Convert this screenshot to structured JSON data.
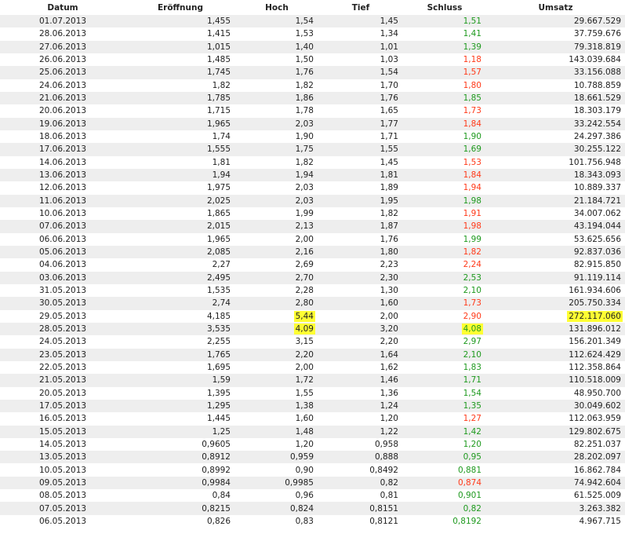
{
  "headers": [
    "Datum",
    "Eröffnung",
    "Hoch",
    "Tief",
    "Schluss",
    "Umsatz"
  ],
  "colors": {
    "up": "#1f9a1f",
    "down": "#ff3a1a",
    "highlight": "#ffff33",
    "stripe": "#eeeeee"
  },
  "rows": [
    {
      "date": "01.07.2013",
      "open": "1,455",
      "high": "1,54",
      "low": "1,45",
      "close": "1,51",
      "trend": "up",
      "volume": "29.667.529"
    },
    {
      "date": "28.06.2013",
      "open": "1,415",
      "high": "1,53",
      "low": "1,34",
      "close": "1,41",
      "trend": "up",
      "volume": "37.759.676"
    },
    {
      "date": "27.06.2013",
      "open": "1,015",
      "high": "1,40",
      "low": "1,01",
      "close": "1,39",
      "trend": "up",
      "volume": "79.318.819"
    },
    {
      "date": "26.06.2013",
      "open": "1,485",
      "high": "1,50",
      "low": "1,03",
      "close": "1,18",
      "trend": "down",
      "volume": "143.039.684"
    },
    {
      "date": "25.06.2013",
      "open": "1,745",
      "high": "1,76",
      "low": "1,54",
      "close": "1,57",
      "trend": "down",
      "volume": "33.156.088"
    },
    {
      "date": "24.06.2013",
      "open": "1,82",
      "high": "1,82",
      "low": "1,70",
      "close": "1,80",
      "trend": "down",
      "volume": "10.788.859"
    },
    {
      "date": "21.06.2013",
      "open": "1,785",
      "high": "1,86",
      "low": "1,76",
      "close": "1,85",
      "trend": "up",
      "volume": "18.661.529"
    },
    {
      "date": "20.06.2013",
      "open": "1,715",
      "high": "1,78",
      "low": "1,65",
      "close": "1,73",
      "trend": "down",
      "volume": "18.303.179"
    },
    {
      "date": "19.06.2013",
      "open": "1,965",
      "high": "2,03",
      "low": "1,77",
      "close": "1,84",
      "trend": "down",
      "volume": "33.242.554"
    },
    {
      "date": "18.06.2013",
      "open": "1,74",
      "high": "1,90",
      "low": "1,71",
      "close": "1,90",
      "trend": "up",
      "volume": "24.297.386"
    },
    {
      "date": "17.06.2013",
      "open": "1,555",
      "high": "1,75",
      "low": "1,55",
      "close": "1,69",
      "trend": "up",
      "volume": "30.255.122"
    },
    {
      "date": "14.06.2013",
      "open": "1,81",
      "high": "1,82",
      "low": "1,45",
      "close": "1,53",
      "trend": "down",
      "volume": "101.756.948"
    },
    {
      "date": "13.06.2013",
      "open": "1,94",
      "high": "1,94",
      "low": "1,81",
      "close": "1,84",
      "trend": "down",
      "volume": "18.343.093"
    },
    {
      "date": "12.06.2013",
      "open": "1,975",
      "high": "2,03",
      "low": "1,89",
      "close": "1,94",
      "trend": "down",
      "volume": "10.889.337"
    },
    {
      "date": "11.06.2013",
      "open": "2,025",
      "high": "2,03",
      "low": "1,95",
      "close": "1,98",
      "trend": "up",
      "volume": "21.184.721"
    },
    {
      "date": "10.06.2013",
      "open": "1,865",
      "high": "1,99",
      "low": "1,82",
      "close": "1,91",
      "trend": "down",
      "volume": "34.007.062"
    },
    {
      "date": "07.06.2013",
      "open": "2,015",
      "high": "2,13",
      "low": "1,87",
      "close": "1,98",
      "trend": "down",
      "volume": "43.194.044"
    },
    {
      "date": "06.06.2013",
      "open": "1,965",
      "high": "2,00",
      "low": "1,76",
      "close": "1,99",
      "trend": "up",
      "volume": "53.625.656"
    },
    {
      "date": "05.06.2013",
      "open": "2,085",
      "high": "2,16",
      "low": "1,80",
      "close": "1,82",
      "trend": "down",
      "volume": "92.837.036"
    },
    {
      "date": "04.06.2013",
      "open": "2,27",
      "high": "2,69",
      "low": "2,23",
      "close": "2,24",
      "trend": "down",
      "volume": "82.915.850"
    },
    {
      "date": "03.06.2013",
      "open": "2,495",
      "high": "2,70",
      "low": "2,30",
      "close": "2,53",
      "trend": "up",
      "volume": "91.119.114"
    },
    {
      "date": "31.05.2013",
      "open": "1,535",
      "high": "2,28",
      "low": "1,30",
      "close": "2,10",
      "trend": "up",
      "volume": "161.934.606"
    },
    {
      "date": "30.05.2013",
      "open": "2,74",
      "high": "2,80",
      "low": "1,60",
      "close": "1,73",
      "trend": "down",
      "volume": "205.750.334"
    },
    {
      "date": "29.05.2013",
      "open": "4,185",
      "high": "5,44",
      "low": "2,00",
      "close": "2,90",
      "trend": "down",
      "volume": "272.117.060",
      "highlight": [
        "high",
        "volume"
      ]
    },
    {
      "date": "28.05.2013",
      "open": "3,535",
      "high": "4,09",
      "low": "3,20",
      "close": "4,08",
      "trend": "up",
      "volume": "131.896.012",
      "highlight": [
        "high",
        "close"
      ]
    },
    {
      "date": "24.05.2013",
      "open": "2,255",
      "high": "3,15",
      "low": "2,20",
      "close": "2,97",
      "trend": "up",
      "volume": "156.201.349"
    },
    {
      "date": "23.05.2013",
      "open": "1,765",
      "high": "2,20",
      "low": "1,64",
      "close": "2,10",
      "trend": "up",
      "volume": "112.624.429"
    },
    {
      "date": "22.05.2013",
      "open": "1,695",
      "high": "2,00",
      "low": "1,62",
      "close": "1,83",
      "trend": "up",
      "volume": "112.358.864"
    },
    {
      "date": "21.05.2013",
      "open": "1,59",
      "high": "1,72",
      "low": "1,46",
      "close": "1,71",
      "trend": "up",
      "volume": "110.518.009"
    },
    {
      "date": "20.05.2013",
      "open": "1,395",
      "high": "1,55",
      "low": "1,36",
      "close": "1,54",
      "trend": "up",
      "volume": "48.950.700"
    },
    {
      "date": "17.05.2013",
      "open": "1,295",
      "high": "1,38",
      "low": "1,24",
      "close": "1,35",
      "trend": "up",
      "volume": "30.049.602"
    },
    {
      "date": "16.05.2013",
      "open": "1,445",
      "high": "1,60",
      "low": "1,20",
      "close": "1,27",
      "trend": "down",
      "volume": "112.063.959"
    },
    {
      "date": "15.05.2013",
      "open": "1,25",
      "high": "1,48",
      "low": "1,22",
      "close": "1,42",
      "trend": "up",
      "volume": "129.802.675"
    },
    {
      "date": "14.05.2013",
      "open": "0,9605",
      "high": "1,20",
      "low": "0,958",
      "close": "1,20",
      "trend": "up",
      "volume": "82.251.037"
    },
    {
      "date": "13.05.2013",
      "open": "0,8912",
      "high": "0,959",
      "low": "0,888",
      "close": "0,95",
      "trend": "up",
      "volume": "28.202.097"
    },
    {
      "date": "10.05.2013",
      "open": "0,8992",
      "high": "0,90",
      "low": "0,8492",
      "close": "0,881",
      "trend": "up",
      "volume": "16.862.784"
    },
    {
      "date": "09.05.2013",
      "open": "0,9984",
      "high": "0,9985",
      "low": "0,82",
      "close": "0,874",
      "trend": "down",
      "volume": "74.942.604"
    },
    {
      "date": "08.05.2013",
      "open": "0,84",
      "high": "0,96",
      "low": "0,81",
      "close": "0,901",
      "trend": "up",
      "volume": "61.525.009"
    },
    {
      "date": "07.05.2013",
      "open": "0,8215",
      "high": "0,824",
      "low": "0,8151",
      "close": "0,82",
      "trend": "up",
      "volume": "3.263.382"
    },
    {
      "date": "06.05.2013",
      "open": "0,826",
      "high": "0,83",
      "low": "0,8121",
      "close": "0,8192",
      "trend": "up",
      "volume": "4.967.715"
    }
  ]
}
